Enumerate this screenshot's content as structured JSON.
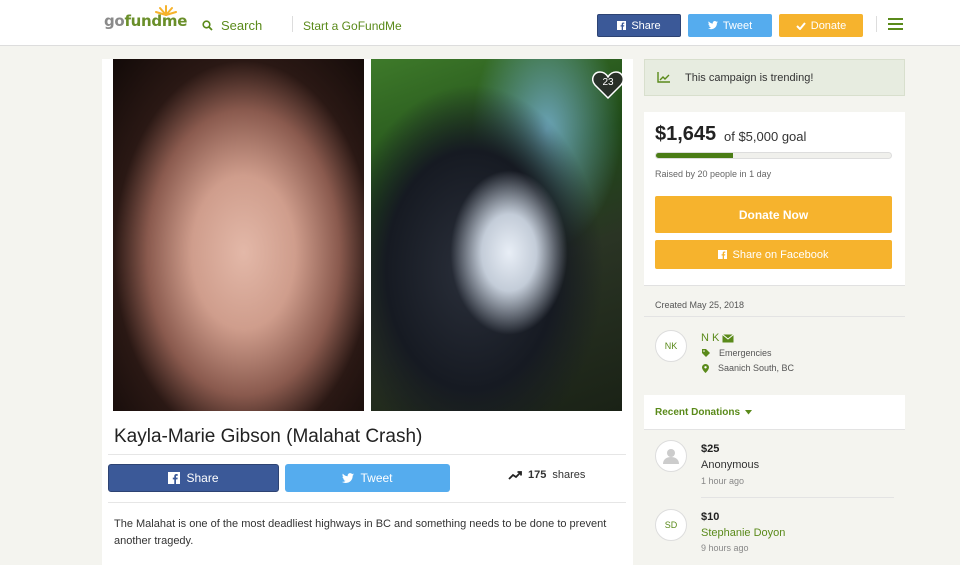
{
  "header": {
    "logo_go": "go",
    "logo_fund": "fundme",
    "search_label": "Search",
    "start_label": "Start a GoFundMe",
    "share_label": "Share",
    "tweet_label": "Tweet",
    "donate_label": "Donate"
  },
  "campaign": {
    "title": "Kayla-Marie Gibson (Malahat Crash)",
    "heart_count": "23",
    "share_label": "Share",
    "tweet_label": "Tweet",
    "shares_count": "175",
    "shares_label": "shares",
    "story": "The Malahat is one of the most deadliest highways in BC and something needs to be done to prevent another tragedy."
  },
  "sidebar": {
    "trending_text": "This campaign is trending!",
    "raised_amount": "$1,645",
    "goal_text": "of $5,000 goal",
    "progress_fraction": 0.329,
    "raised_text": "Raised by 20 people in 1 day",
    "donate_now_label": "Donate Now",
    "share_facebook_label": "Share on Facebook",
    "created_text": "Created May 25, 2018",
    "organizer": {
      "initials": "NK",
      "name": "N K",
      "category": "Emergencies",
      "location": "Saanich South, BC"
    },
    "recent_donations_label": "Recent Donations",
    "donations": [
      {
        "amount": "$25",
        "name": "Anonymous",
        "time": "1 hour ago",
        "initials": ""
      },
      {
        "amount": "$10",
        "name": "Stephanie Doyon",
        "time": "9 hours ago",
        "initials": "SD"
      }
    ]
  },
  "colors": {
    "brand_green": "#5a8a1a",
    "facebook": "#3b5998",
    "twitter": "#55acee",
    "donate": "#f6b32d"
  }
}
